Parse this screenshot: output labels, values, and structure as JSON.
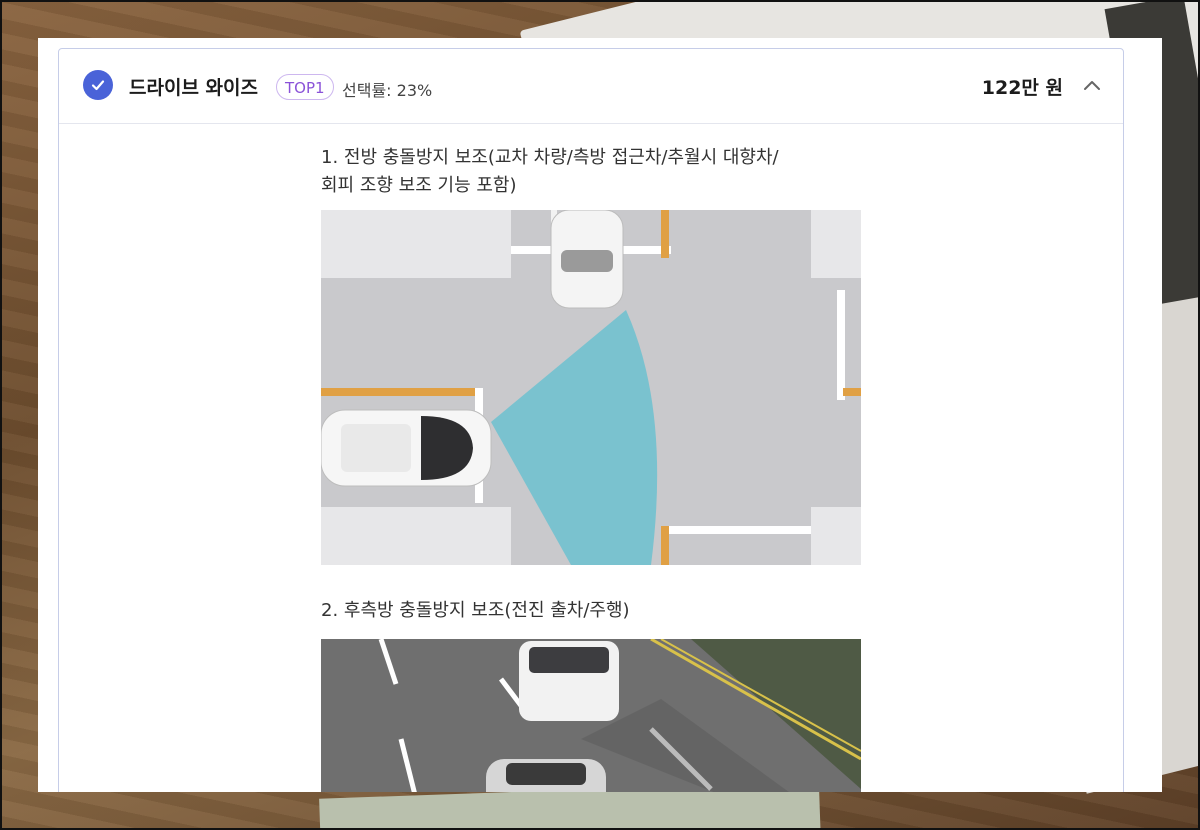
{
  "option": {
    "name": "드라이브 와이즈",
    "badge": "TOP1",
    "selection_rate": "선택률: 23%",
    "price": "122만 원",
    "checked": true,
    "expanded": true
  },
  "features": [
    {
      "title": "1. 전방 충돌방지 보조(교차 차량/측방 접근차/추월시 대향차/\n회피 조향 보조 기능 포함)",
      "image": "front-collision-assist-diagram"
    },
    {
      "title": "2. 후측방 충돌방지 보조(전진 출차/주행)",
      "image": "rear-side-collision-assist-photo"
    }
  ],
  "colors": {
    "check": "#4a63d8",
    "badge_text": "#8a52d8",
    "badge_border": "#cdb7ef",
    "card_border": "#c6cde8",
    "sensor_zone": "#6cc1cf"
  },
  "icons": {
    "check": "check-icon",
    "collapse": "chevron-up-icon"
  }
}
